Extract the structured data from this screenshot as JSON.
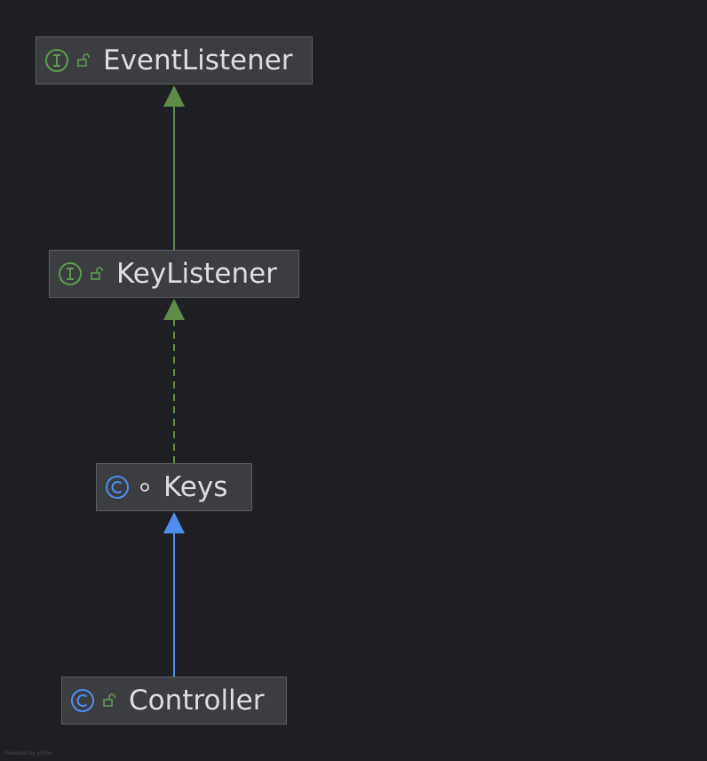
{
  "diagram": {
    "nodes": [
      {
        "id": "EventListener",
        "name": "EventListener",
        "kind": "interface",
        "visibility": "public"
      },
      {
        "id": "KeyListener",
        "name": "KeyListener",
        "kind": "interface",
        "visibility": "public"
      },
      {
        "id": "Keys",
        "name": "Keys",
        "kind": "class",
        "visibility": "package-private"
      },
      {
        "id": "Controller",
        "name": "Controller",
        "kind": "class",
        "visibility": "public"
      }
    ],
    "edges": [
      {
        "from": "KeyListener",
        "to": "EventListener",
        "relation": "extends",
        "style": "solid",
        "color": "#5f8c46"
      },
      {
        "from": "Keys",
        "to": "KeyListener",
        "relation": "implements",
        "style": "dashed",
        "color": "#5f8c46"
      },
      {
        "from": "Controller",
        "to": "Keys",
        "relation": "extends",
        "style": "solid",
        "color": "#4e8ef0"
      }
    ],
    "icons": {
      "interface": "interface-i-icon",
      "class": "class-c-icon",
      "public": "unlocked-padlock-icon",
      "package-private": "circle-dot-icon"
    },
    "colors": {
      "background": "#1f2023",
      "node_fill": "#3c3d40",
      "node_border": "#5d5e62",
      "text": "#dddee0",
      "interface_icon": "#5f9a52",
      "class_icon": "#4e8ef0",
      "public_lock": "#5f9a52"
    }
  },
  "footer": {
    "powered_by": "Powered by yFiles"
  }
}
